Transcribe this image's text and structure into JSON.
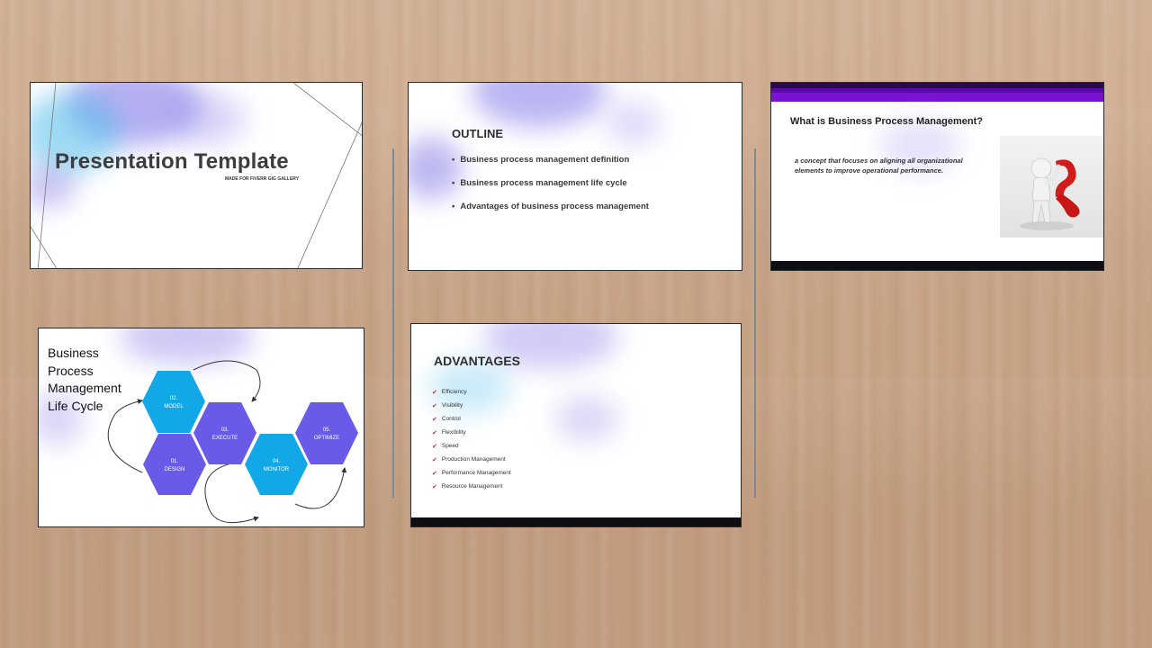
{
  "slides": {
    "cover": {
      "title": "Presentation Template",
      "subtitle": "MADE FOR FIVERR GIG GALLERY"
    },
    "outline": {
      "heading": "OUTLINE",
      "items": [
        "Business process management definition",
        "Business process management life cycle",
        "Advantages of business process management"
      ]
    },
    "definition": {
      "title": "What is Business Process Management?",
      "body": "a concept that focuses on aligning all organizational elements to improve operational performance.",
      "image_icon": "figure-with-question-mark-icon",
      "bar_colors": [
        "#2a0a4a",
        "#5a0aa8",
        "#7a12d4"
      ]
    },
    "lifecycle": {
      "title_lines": [
        "Business",
        "Process",
        "Management",
        "Life Cycle"
      ],
      "steps": [
        {
          "number": "01.",
          "label": "DESIGN",
          "color": "#6a5ae8"
        },
        {
          "number": "02.",
          "label": "MODEL",
          "color": "#12a8e8"
        },
        {
          "number": "03.",
          "label": "EXECUTE",
          "color": "#6a5ae8"
        },
        {
          "number": "04.",
          "label": "MONITOR",
          "color": "#12a8e8"
        },
        {
          "number": "05.",
          "label": "OPTIMIZE",
          "color": "#6a5ae8"
        }
      ]
    },
    "advantages": {
      "heading": "ADVANTAGES",
      "check_icon": "check-icon",
      "items": [
        "Efficiency",
        "Visibility",
        "Control",
        "Flexibility",
        "Speed",
        "Production Management",
        "Performance Management",
        "Resource Management"
      ]
    }
  }
}
